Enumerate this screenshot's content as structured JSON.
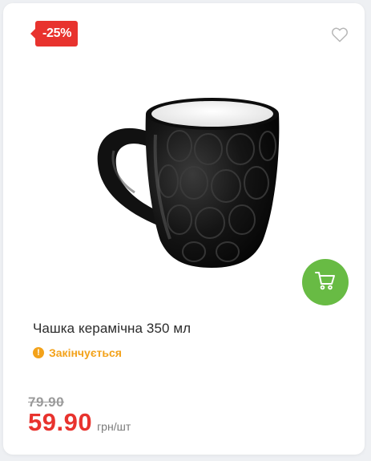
{
  "product": {
    "discount_badge": "-25%",
    "title": "Чашка керамічна 350 мл",
    "stock_status": "Закінчується",
    "old_price": "79.90",
    "price": "59.90",
    "price_unit": "грн/шт"
  },
  "colors": {
    "discount": "#e8332e",
    "cart_button": "#68bb44",
    "status_warning": "#f3a21a",
    "price": "#e8332e"
  },
  "icons": {
    "favorite": "heart-icon",
    "cart": "cart-icon",
    "status": "warning-icon"
  }
}
